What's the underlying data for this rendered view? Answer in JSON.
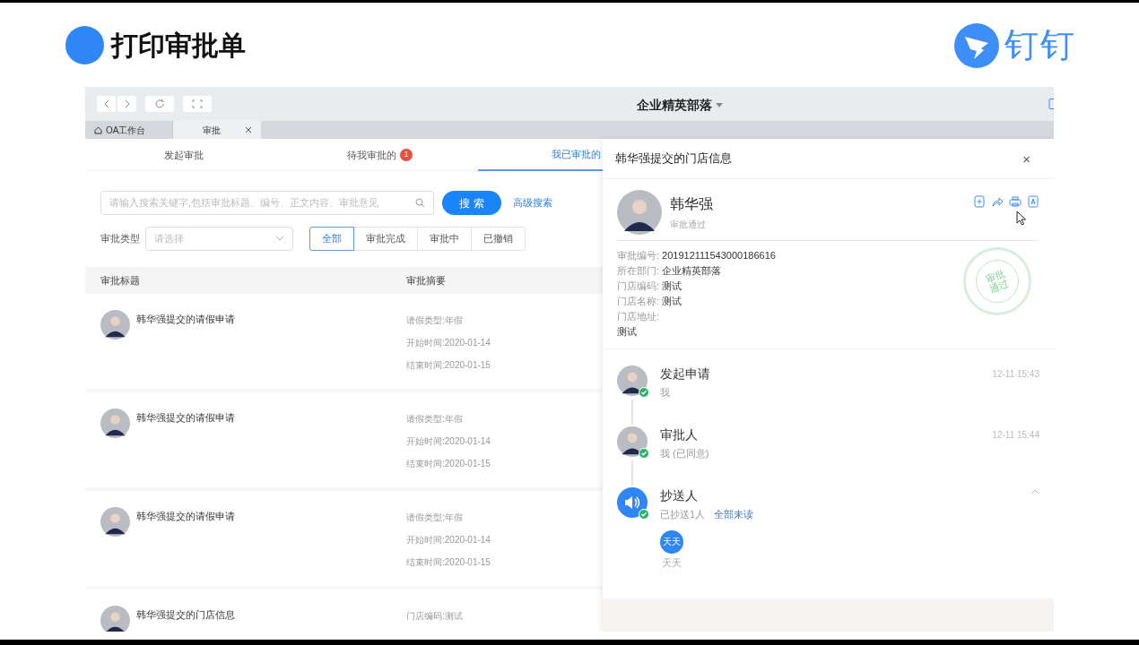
{
  "slide": {
    "title": "打印审批单",
    "logo_text": "钉钉"
  },
  "app": {
    "toolbar_title": "企业精英部落",
    "tabs": [
      {
        "label": "OA工作台",
        "kind": "home",
        "selected": false,
        "closable": false
      },
      {
        "label": "审批",
        "kind": "plain",
        "selected": true,
        "closable": true
      }
    ],
    "nav_tabs": [
      {
        "label": "发起审批",
        "selected": false
      },
      {
        "label": "待我审批的",
        "badge": "1",
        "selected": false
      },
      {
        "label": "我已审批的",
        "selected": true
      }
    ],
    "search": {
      "placeholder": "请输入搜索关键字,包括审批标题、编号、正文内容、审批意见",
      "button": "搜 索",
      "advanced_link": "高级搜索"
    },
    "filter": {
      "label": "审批类型",
      "placeholder": "请选择",
      "segments": [
        {
          "label": "全部",
          "selected": true
        },
        {
          "label": "审批完成",
          "selected": false
        },
        {
          "label": "审批中",
          "selected": false
        },
        {
          "label": "已撤销",
          "selected": false
        }
      ]
    },
    "table": {
      "columns": [
        "审批标题",
        "审批摘要"
      ],
      "rows": [
        {
          "title": "韩华强提交的请假申请",
          "summary": [
            "请假类型:年假",
            "开始时间:2020-01-14",
            "结束时间:2020-01-15"
          ]
        },
        {
          "title": "韩华强提交的请假申请",
          "summary": [
            "请假类型:年假",
            "开始时间:2020-01-14",
            "结束时间:2020-01-15"
          ]
        },
        {
          "title": "韩华强提交的请假申请",
          "summary": [
            "请假类型:年假",
            "开始时间:2020-01-14",
            "结束时间:2020-01-15"
          ]
        },
        {
          "title": "韩华强提交的门店信息",
          "summary": [
            "门店编码:测试"
          ]
        }
      ]
    }
  },
  "detail": {
    "title": "韩华强提交的门店信息",
    "close": "×",
    "applicant": {
      "name": "韩华强",
      "status": "审批通过"
    },
    "fields": [
      {
        "label": "审批编号:",
        "value": "201912111543000186616"
      },
      {
        "label": "所在部门:",
        "value": "企业精英部落"
      },
      {
        "label": "门店编码:",
        "value": "测试"
      },
      {
        "label": "门店名称:",
        "value": "测试"
      },
      {
        "label": "门店地址:",
        "value": "测试",
        "block": true
      }
    ],
    "stamp": "审批通过",
    "timeline": [
      {
        "kind": "person",
        "title": "发起申请",
        "subtitle": "我",
        "time": "12-11 15:43"
      },
      {
        "kind": "person",
        "title": "审批人",
        "subtitle": "我 (已同意)",
        "time": "12-11 15:44"
      },
      {
        "kind": "cc",
        "title": "抄送人",
        "subtitle": "已抄送1人",
        "link": "全部未读",
        "expanded": true,
        "recipients": [
          {
            "initials": "天天",
            "name": "天天"
          }
        ]
      }
    ]
  }
}
